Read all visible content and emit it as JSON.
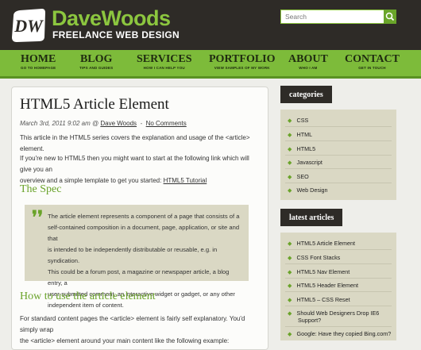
{
  "header": {
    "logo_initials": "DW",
    "brand": "DaveWoods",
    "tagline": "FREELANCE WEB DESIGN",
    "search_placeholder": "Search"
  },
  "nav": [
    {
      "label": "HOME",
      "sub": "GO TO HOMEPAGE"
    },
    {
      "label": "BLOG",
      "sub": "TIPS AND GUIDES"
    },
    {
      "label": "SERVICES",
      "sub": "HOW I CAN HELP YOU"
    },
    {
      "label": "PORTFOLIO",
      "sub": "VIEW SAMPLES OF MY WORK"
    },
    {
      "label": "ABOUT",
      "sub": "WHO I AM"
    },
    {
      "label": "CONTACT",
      "sub": "GET IN TOUCH"
    }
  ],
  "article": {
    "title": "HTML5 Article Element",
    "date": "March 3rd, 2011  9:02 am @",
    "author": "Dave Woods",
    "comments": "No Comments",
    "intro": "This article in the HTML5 series covers the explanation and usage of the <article> element.",
    "para2_line1": "If you're new to HTML5 then you might want to start at the following link which will give you an",
    "para2_line2": "overview and a simple template to get you started:",
    "tutorial_link": "HTML5 Tutorial",
    "spec_heading": "The Spec",
    "quote_lines": [
      "The article element represents a component of a page that consists of a",
      "self-contained composition in a document, page, application, or site and that",
      "is intended to be independently distributable or reusable, e.g. in syndication.",
      "This could be a forum post, a magazine or newspaper article, a blog entry, a",
      "user-submitted comment, an interactive widget or gadget, or any other",
      "independent item of content."
    ],
    "howto_heading": "How to use the article element",
    "howto_line1": "For standard content pages the <article> element is fairly self explanatory.  You'd simply wrap",
    "howto_line2": "the <article> element around your main content like the following example:"
  },
  "sidebar": {
    "categories_title": "categories",
    "categories": [
      "CSS",
      "HTML",
      "HTML5",
      "Javascript",
      "SEO",
      "Web Design"
    ],
    "latest_title": "latest articles",
    "latest": [
      "HTML5 Article Element",
      "CSS Font Stacks",
      "HTML5 Nav Element",
      "HTML5 Header Element",
      "HTML5 – CSS Reset",
      "Should Web Designers Drop IE6",
      "Support?",
      "Google: Have they copied Bing.com?"
    ]
  },
  "colors": {
    "accent": "#7dbb3a",
    "dark": "#2e2b27",
    "panel": "#dad8c4"
  }
}
